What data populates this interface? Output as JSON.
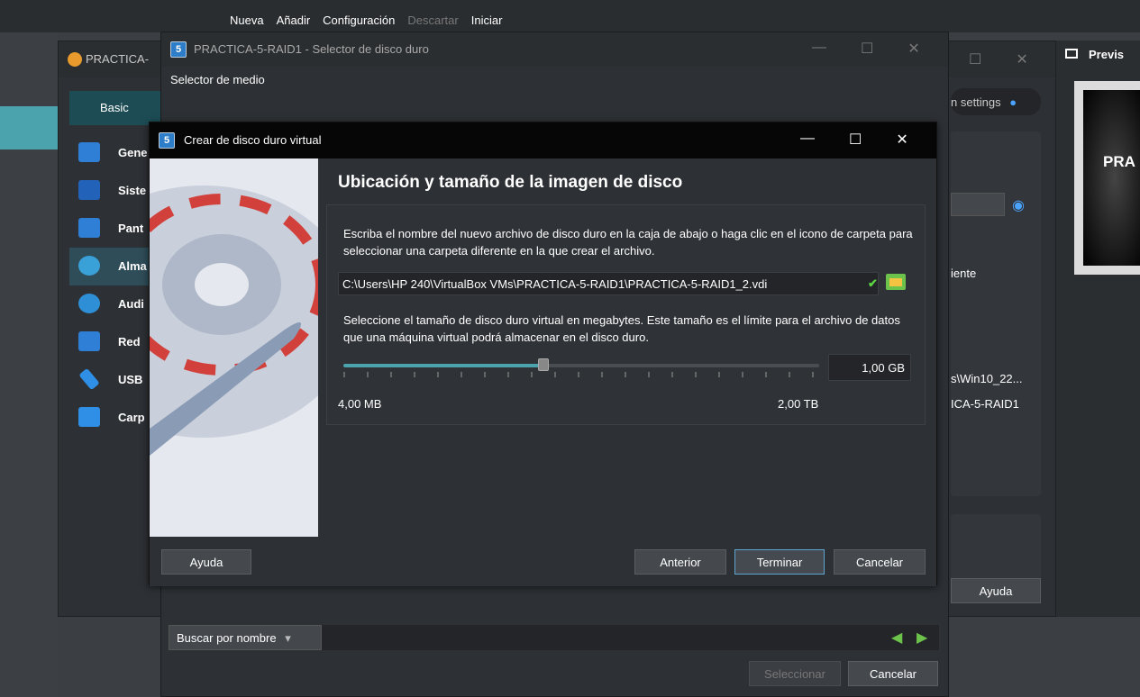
{
  "mainbar": {
    "nueva": "Nueva",
    "anadir": "Añadir",
    "configuracion": "Configuración",
    "descartar": "Descartar",
    "iniciar": "Iniciar"
  },
  "settings": {
    "title": "PRACTICA-",
    "basic": "Basic",
    "nav": [
      "Gene",
      "Siste",
      "Pant",
      "Alma",
      "Audi",
      "Red",
      "USB",
      "Carp"
    ],
    "search_hint": "n settings",
    "right_frag_1": "iente",
    "right_frag_2": "s\\Win10_22...",
    "right_frag_3": "ICA-5-RAID1",
    "help": "Ayuda"
  },
  "preview": {
    "title": "Previs",
    "screen_text": "PRA"
  },
  "selector": {
    "title": "PRACTICA-5-RAID1 - Selector de disco duro",
    "medio": "Selector de medio",
    "search_mode": "Buscar por nombre",
    "select": "Seleccionar",
    "cancel": "Cancelar"
  },
  "wizard": {
    "title": "Crear de disco duro virtual",
    "heading": "Ubicación y tamaño de la imagen de disco",
    "para1": "Escriba el nombre del nuevo archivo de disco duro en la caja de abajo o haga clic en el icono de carpeta para seleccionar una carpeta diferente en la que crear el archivo.",
    "path": "C:\\Users\\HP 240\\VirtualBox VMs\\PRACTICA-5-RAID1\\PRACTICA-5-RAID1_2.vdi",
    "para2": "Seleccione el tamaño de disco duro virtual en megabytes. Este tamaño es el límite para el archivo de datos que una máquina virtual podrá almacenar en el disco duro.",
    "size": "1,00 GB",
    "slider_fraction": 0.42,
    "min_label": "4,00 MB",
    "max_label": "2,00 TB",
    "help": "Ayuda",
    "back": "Anterior",
    "finish": "Terminar",
    "cancel": "Cancelar"
  },
  "colors": {
    "accent": "#4aa3ad",
    "title_bg": "#060606"
  }
}
